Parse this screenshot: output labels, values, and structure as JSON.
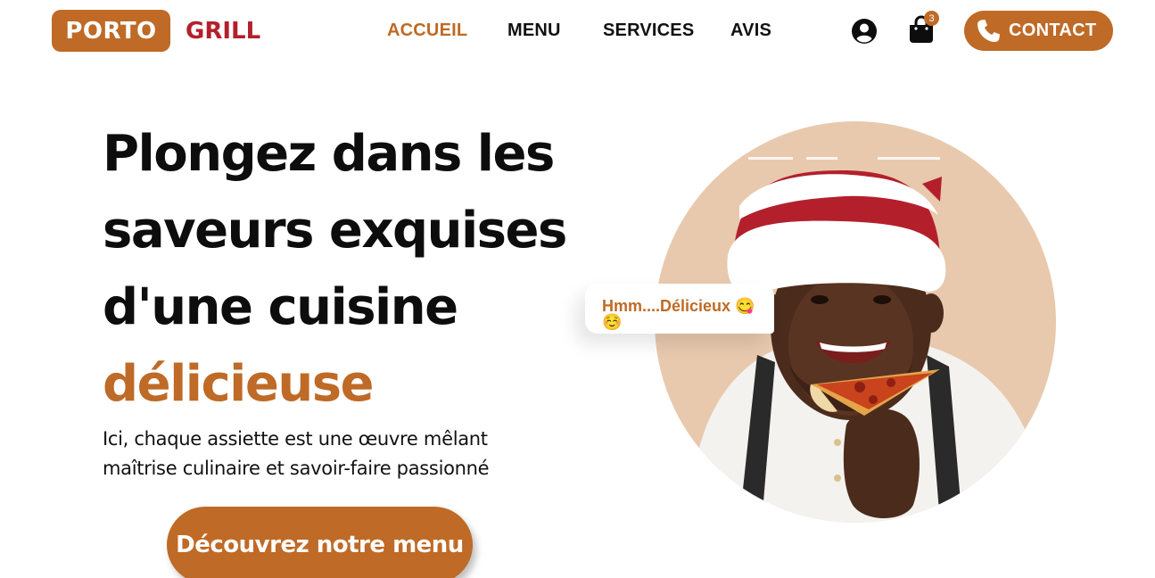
{
  "brand": {
    "name_part1": "PORTO",
    "name_part2": "GRILL"
  },
  "nav": {
    "items": [
      {
        "label": "ACCUEIL",
        "active": true
      },
      {
        "label": "MENU",
        "active": false
      },
      {
        "label": "SERVICES",
        "active": false
      },
      {
        "label": "AVIS",
        "active": false
      }
    ],
    "cart_count": "3",
    "contact_label": "CONTACT"
  },
  "hero": {
    "title_line1": "Plongez dans les",
    "title_line2": "saveurs exquises",
    "title_line3": "d'une cuisine",
    "title_accent": "délicieuse",
    "subtitle": "Ici, chaque assiette est une œuvre mêlant maîtrise culinaire et savoir-faire passionné",
    "cta_label": "Découvrez notre menu",
    "bubble_text": "Hmm....Délicieux 😋 ☺️"
  },
  "colors": {
    "accent": "#bf6a26",
    "brand_red": "#b3202c",
    "circle_bg": "#e8c9ae"
  },
  "icons": {
    "user": "user-circle-icon",
    "cart": "shopping-bag-icon",
    "phone": "phone-icon"
  }
}
